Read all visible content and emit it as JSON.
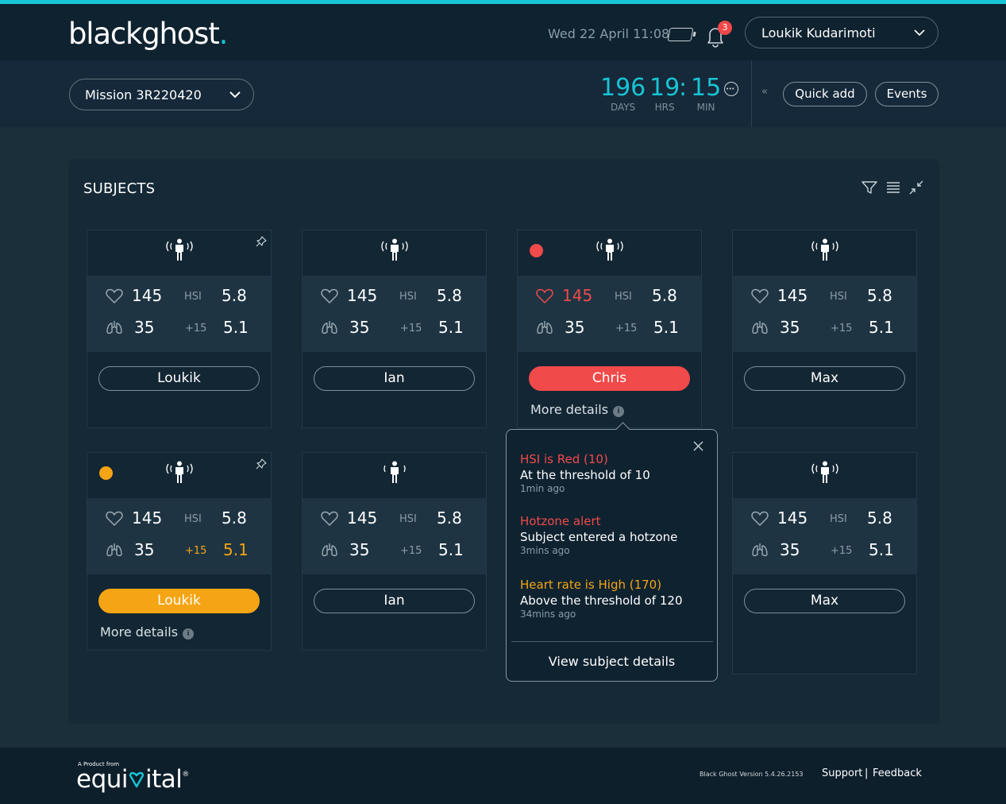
{
  "header": {
    "logo_main": "blackghost",
    "logo_dot": ".",
    "datetime": "Wed 22 April 11:08",
    "notification_count": "3",
    "user_name": "Loukik Kudarimoti",
    "icons": [
      "battery-icon",
      "bell-icon",
      "chevron-down-icon"
    ]
  },
  "mission": {
    "label": "Mission 3R220420",
    "timer": {
      "days": "196",
      "days_label": "DAYS",
      "hours": "19",
      "hours_label": "HRS",
      "separator": ":",
      "minutes": "15",
      "minutes_label": "MIN"
    },
    "collapse": "«",
    "quick_add": "Quick add",
    "events": "Events"
  },
  "panel": {
    "title": "SUBJECTS",
    "tools": [
      "filter-icon",
      "list-icon",
      "collapse-icon"
    ]
  },
  "subjects": [
    {
      "name": "Loukik",
      "heart": "145",
      "hsi_label": "HSI",
      "hsi": "5.8",
      "resp": "35",
      "delta": "+15",
      "val2": "5.1",
      "status": "none",
      "pinned": true
    },
    {
      "name": "Ian",
      "heart": "145",
      "hsi_label": "HSI",
      "hsi": "5.8",
      "resp": "35",
      "delta": "+15",
      "val2": "5.1",
      "status": "none",
      "pinned": false
    },
    {
      "name": "Chris",
      "heart": "145",
      "hsi_label": "HSI",
      "hsi": "5.8",
      "resp": "35",
      "delta": "+15",
      "val2": "5.1",
      "status": "red",
      "pinned": false,
      "more": "More details"
    },
    {
      "name": "Max",
      "heart": "145",
      "hsi_label": "HSI",
      "hsi": "5.8",
      "resp": "35",
      "delta": "+15",
      "val2": "5.1",
      "status": "none",
      "pinned": false
    },
    {
      "name": "Loukik",
      "heart": "145",
      "hsi_label": "HSI",
      "hsi": "5.8",
      "resp": "35",
      "delta": "+15",
      "val2": "5.1",
      "status": "amber",
      "pinned": true,
      "more": "More details"
    },
    {
      "name": "Ian",
      "heart": "145",
      "hsi_label": "HSI",
      "hsi": "5.8",
      "resp": "35",
      "delta": "+15",
      "val2": "5.1",
      "status": "none",
      "pinned": false
    },
    {
      "name": "Max",
      "heart": "145",
      "hsi_label": "HSI",
      "hsi": "5.8",
      "resp": "35",
      "delta": "+15",
      "val2": "5.1",
      "status": "none",
      "pinned": false
    }
  ],
  "info_glyph": "i",
  "popover": {
    "alerts": [
      {
        "title": "HSI is Red (10)",
        "message": "At the threshold of 10",
        "time": "1min ago",
        "level": "red"
      },
      {
        "title": "Hotzone alert",
        "message": "Subject entered a hotzone",
        "time": "3mins ago",
        "level": "red"
      },
      {
        "title": "Heart rate is High (170)",
        "message": "Above the threshold of 120",
        "time": "34mins ago",
        "level": "amber"
      }
    ],
    "link": "View subject details"
  },
  "footer": {
    "tagline": "A Product from",
    "brand_left": "equi",
    "brand_right": "ital",
    "reg": "®",
    "version": "Black Ghost Version 5.4.26.2153",
    "support": "Support",
    "separator": "|",
    "feedback": "Feedback"
  },
  "colors": {
    "accent": "#17c6d6",
    "alert_red": "#f04a4a",
    "alert_amber": "#f5a513",
    "background": "#1b2f3a"
  }
}
